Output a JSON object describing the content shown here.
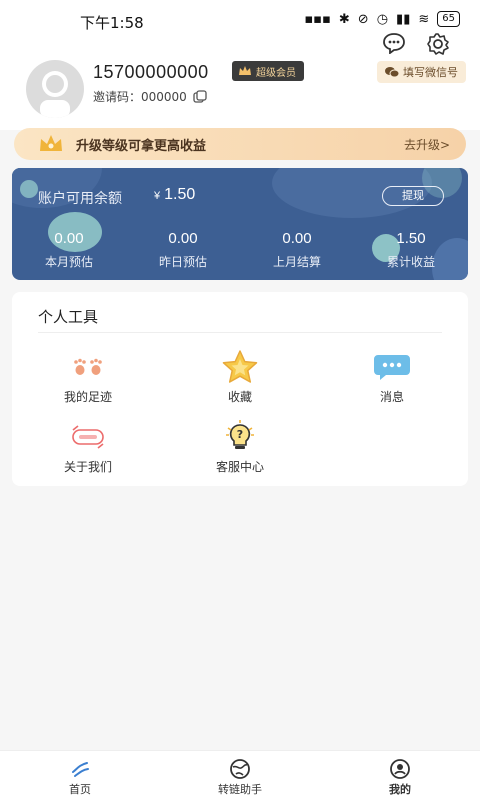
{
  "status_bar": {
    "time": "下午1:58",
    "battery": "65"
  },
  "profile": {
    "phone": "15700000000",
    "vip_badge": "超级会员",
    "invite_label": "邀请码：000000",
    "wechat_button": "填写微信号"
  },
  "upgrade_banner": {
    "text": "升级等级可拿更高收益",
    "link": "去升级>"
  },
  "balance_card": {
    "label": "账户可用余额",
    "currency": "¥",
    "amount": "1.50",
    "withdraw_button": "提现",
    "stats": [
      {
        "value": "0.00",
        "label": "本月预估"
      },
      {
        "value": "0.00",
        "label": "昨日预估"
      },
      {
        "value": "0.00",
        "label": "上月结算"
      },
      {
        "value": "1.50",
        "label": "累计收益"
      }
    ]
  },
  "tools": {
    "title": "个人工具",
    "items": [
      {
        "label": "我的足迹",
        "icon": "footprint-icon"
      },
      {
        "label": "收藏",
        "icon": "star-icon"
      },
      {
        "label": "消息",
        "icon": "chat-bubble-icon"
      },
      {
        "label": "关于我们",
        "icon": "about-icon"
      },
      {
        "label": "客服中心",
        "icon": "lightbulb-help-icon"
      }
    ]
  },
  "tabbar": {
    "items": [
      {
        "label": "首页",
        "icon": "home-icon"
      },
      {
        "label": "转链助手",
        "icon": "globe-icon"
      },
      {
        "label": "我的",
        "icon": "user-icon"
      }
    ]
  },
  "colors": {
    "card_blue": "#3d5f93",
    "banner_gold": "#f6d2a8",
    "vip_dark": "#3b3b3b"
  }
}
